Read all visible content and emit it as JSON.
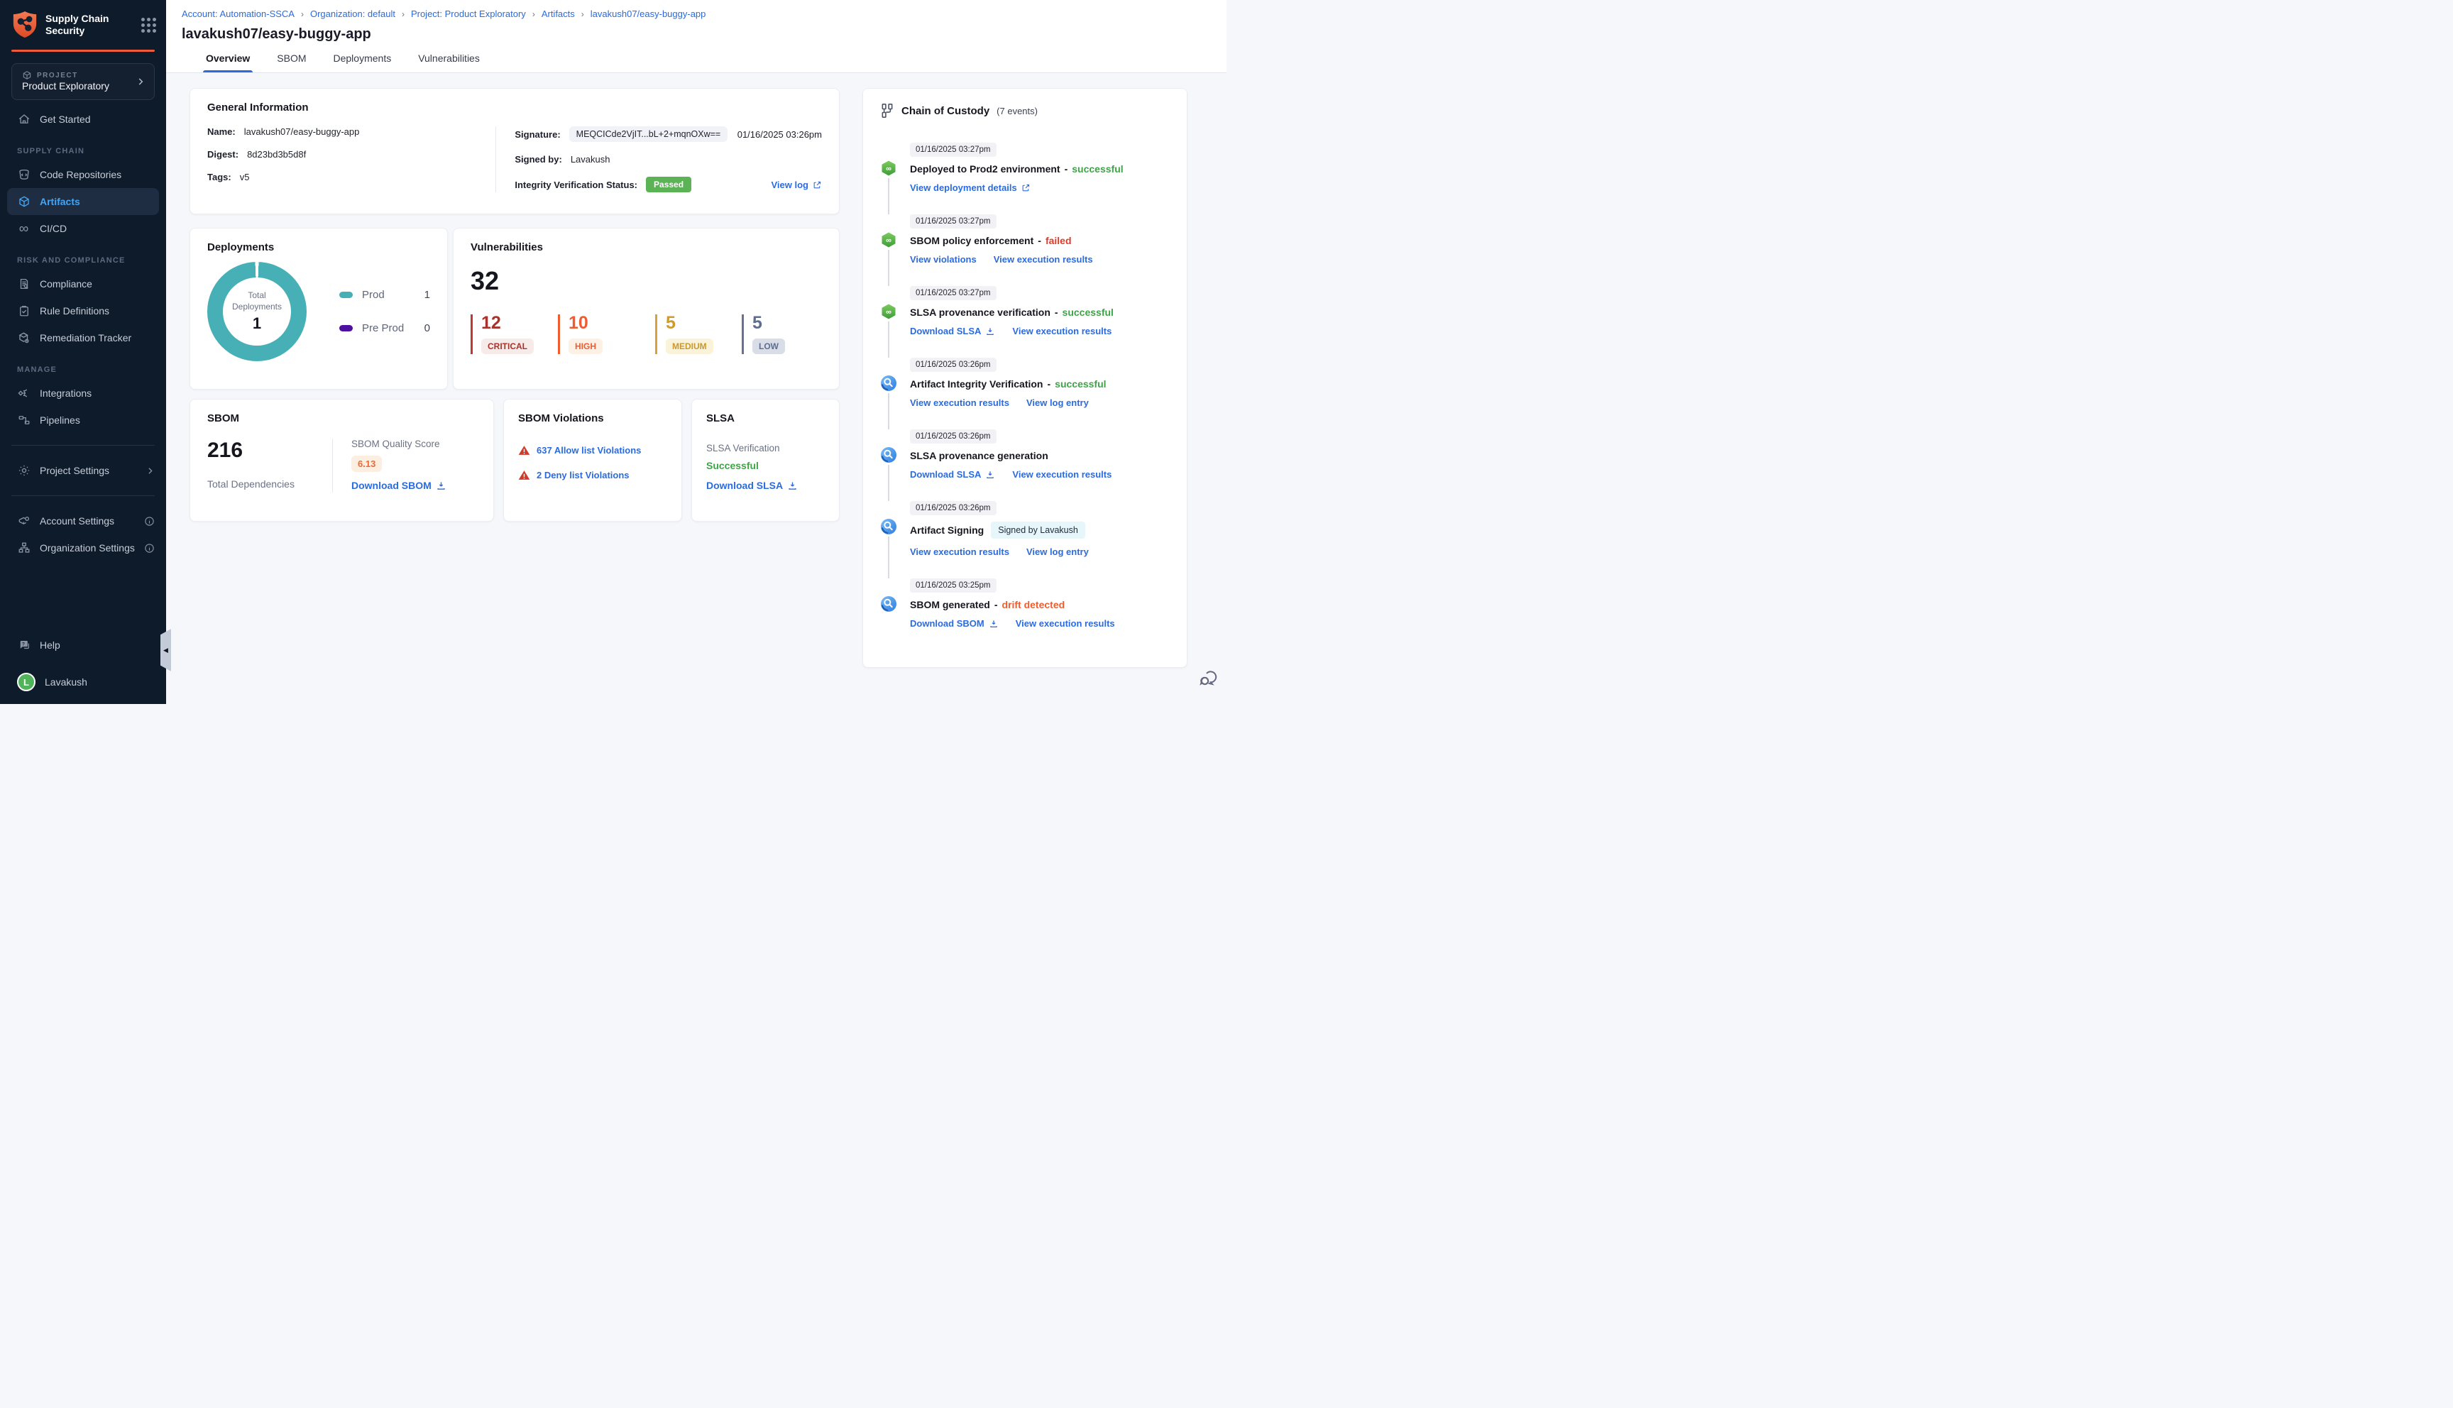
{
  "sidebar": {
    "app_title": "Supply Chain Security",
    "project": {
      "label": "PROJECT",
      "name": "Product Exploratory"
    },
    "get_started": "Get Started",
    "sections": [
      {
        "label": "SUPPLY CHAIN",
        "items": [
          {
            "label": "Code Repositories"
          },
          {
            "label": "Artifacts"
          },
          {
            "label": "CI/CD"
          }
        ]
      },
      {
        "label": "RISK AND COMPLIANCE",
        "items": [
          {
            "label": "Compliance"
          },
          {
            "label": "Rule Definitions"
          },
          {
            "label": "Remediation Tracker"
          }
        ]
      },
      {
        "label": "MANAGE",
        "items": [
          {
            "label": "Integrations"
          },
          {
            "label": "Pipelines"
          }
        ]
      }
    ],
    "project_settings": "Project Settings",
    "account_settings": "Account Settings",
    "organization_settings": "Organization Settings",
    "help": "Help",
    "user": {
      "name": "Lavakush",
      "initial": "L"
    }
  },
  "header": {
    "breadcrumb": [
      "Account: Automation-SSCA",
      "Organization: default",
      "Project: Product Exploratory",
      "Artifacts",
      "lavakush07/easy-buggy-app"
    ],
    "title": "lavakush07/easy-buggy-app",
    "tabs": [
      {
        "label": "Overview"
      },
      {
        "label": "SBOM"
      },
      {
        "label": "Deployments"
      },
      {
        "label": "Vulnerabilities"
      }
    ],
    "active_tab": "Overview"
  },
  "general_info": {
    "title": "General Information",
    "name_label": "Name:",
    "name": "lavakush07/easy-buggy-app",
    "digest_label": "Digest:",
    "digest": "8d23bd3b5d8f",
    "tags_label": "Tags:",
    "tags": "v5",
    "signature_label": "Signature:",
    "signature": "MEQCICde2VjIT...bL+2+mqnOXw==",
    "signature_time": "01/16/2025 03:26pm",
    "signed_by_label": "Signed by:",
    "signed_by": "Lavakush",
    "integrity_label": "Integrity Verification Status:",
    "integrity_status": "Passed",
    "view_log": "View log"
  },
  "deployments": {
    "title": "Deployments",
    "center_label": "Total Deployments",
    "center_value": "1",
    "legend": [
      {
        "label": "Prod",
        "value": "1",
        "color": "#47b0b6"
      },
      {
        "label": "Pre Prod",
        "value": "0",
        "color": "#4d10a0"
      }
    ],
    "chart_data": {
      "type": "pie",
      "categories": [
        "Prod",
        "Pre Prod"
      ],
      "values": [
        1,
        0
      ],
      "title": "Total Deployments",
      "total": 1
    }
  },
  "vulnerabilities": {
    "title": "Vulnerabilities",
    "total": "32",
    "severities": [
      {
        "count": "12",
        "label": "CRITICAL",
        "color": "#a8332c"
      },
      {
        "count": "10",
        "label": "HIGH",
        "color": "#ee5c33"
      },
      {
        "count": "5",
        "label": "MEDIUM",
        "color": "#cf9b2e"
      },
      {
        "count": "5",
        "label": "LOW",
        "color": "#5f6e8c"
      }
    ]
  },
  "sbom": {
    "title": "SBOM",
    "total": "216",
    "total_label": "Total Dependencies",
    "quality_label": "SBOM Quality Score",
    "quality_score": "6.13",
    "download": "Download SBOM"
  },
  "sbom_violations": {
    "title": "SBOM Violations",
    "items": [
      {
        "label": "637 Allow list Violations"
      },
      {
        "label": "2 Deny list Violations"
      }
    ]
  },
  "slsa": {
    "title": "SLSA",
    "verification_label": "SLSA Verification",
    "status": "Successful",
    "download": "Download SLSA"
  },
  "chain": {
    "title": "Chain of Custody",
    "count": "(7 events)",
    "events": [
      {
        "time": "01/16/2025 03:27pm",
        "title": "Deployed to Prod2 environment",
        "sep": "-",
        "status": "successful",
        "links": [
          {
            "label": "View deployment details"
          }
        ]
      },
      {
        "time": "01/16/2025 03:27pm",
        "title": "SBOM policy enforcement",
        "sep": "-",
        "status": "failed",
        "links": [
          {
            "label": "View violations"
          },
          {
            "label": "View execution results"
          }
        ]
      },
      {
        "time": "01/16/2025 03:27pm",
        "title": "SLSA provenance verification",
        "sep": "-",
        "status": "successful",
        "links": [
          {
            "label": "Download SLSA"
          },
          {
            "label": "View execution results"
          }
        ]
      },
      {
        "time": "01/16/2025 03:26pm",
        "title": "Artifact Integrity Verification",
        "sep": "-",
        "status": "successful",
        "links": [
          {
            "label": "View execution results"
          },
          {
            "label": "View log entry"
          }
        ]
      },
      {
        "time": "01/16/2025 03:26pm",
        "title": "SLSA provenance generation",
        "links": [
          {
            "label": "Download SLSA"
          },
          {
            "label": "View execution results"
          }
        ]
      },
      {
        "time": "01/16/2025 03:26pm",
        "title": "Artifact Signing",
        "badge": "Signed by Lavakush",
        "links": [
          {
            "label": "View execution results"
          },
          {
            "label": "View log entry"
          }
        ]
      },
      {
        "time": "01/16/2025 03:25pm",
        "title": "SBOM generated",
        "sep": "-",
        "status": "drift detected",
        "links": [
          {
            "label": "Download SBOM"
          },
          {
            "label": "View execution results"
          }
        ]
      }
    ]
  },
  "colors": {
    "accent_orange": "#ee5a3a",
    "link_blue": "#2b6be0",
    "active_nav_blue": "#42a5f5",
    "success_green": "#3fa348",
    "error_red": "#dc3b2a",
    "drift_orange": "#f05c2e",
    "passed_badge_green": "#5cb356",
    "donut_teal": "#47b0b6",
    "preprod_purple": "#4d10a0",
    "sidebar_bg": "#0d1b2b"
  }
}
